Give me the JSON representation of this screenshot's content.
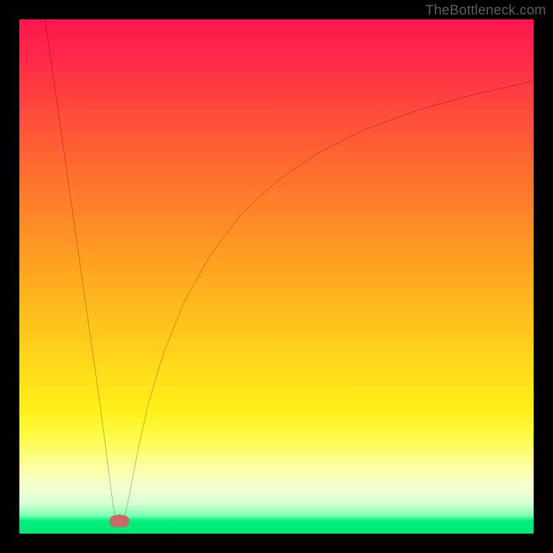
{
  "watermark": {
    "text": "TheBottleneck.com"
  },
  "colors": {
    "curve_stroke": "#000000",
    "marker_fill": "#c96864",
    "gradient_top": "#ff154e",
    "gradient_bottom": "#00e676",
    "frame": "#000000"
  },
  "chart_data": {
    "type": "line",
    "title": "",
    "xlabel": "",
    "ylabel": "",
    "xlim": [
      0,
      100
    ],
    "ylim": [
      0,
      100
    ],
    "axes_visible": false,
    "grid": false,
    "gradient_background": {
      "direction": "vertical",
      "stops": [
        {
          "pos": 0.0,
          "color": "#ff154e"
        },
        {
          "pos": 0.3,
          "color": "#ff6f2e"
        },
        {
          "pos": 0.6,
          "color": "#ffd61a"
        },
        {
          "pos": 0.86,
          "color": "#fcffa2"
        },
        {
          "pos": 0.965,
          "color": "#7dffb4"
        },
        {
          "pos": 1.0,
          "color": "#00e676"
        }
      ]
    },
    "series": [
      {
        "name": "bottleneck-curve",
        "comment": "y is bottleneck percentage (0 best at minimum, ~100 at x=0 top-left). Curve has sharp V minimum near x≈19 and asymptotically rises to ~88 at x=100.",
        "x": [
          5,
          7,
          9,
          11,
          13,
          15,
          16.5,
          17.5,
          18.3,
          19.0,
          19.8,
          20.6,
          21.5,
          23,
          25,
          28,
          32,
          37,
          43,
          50,
          58,
          67,
          77,
          88,
          100
        ],
        "y": [
          100,
          86,
          72,
          58,
          44,
          30,
          19,
          11,
          5,
          2.2,
          2.1,
          3.8,
          8,
          16,
          25,
          35,
          45,
          54,
          62,
          68.5,
          74,
          78.5,
          82.2,
          85.3,
          88
        ]
      }
    ],
    "markers": [
      {
        "name": "min-left-lobe",
        "x": 18.7,
        "y": 2.4,
        "r": 1.2,
        "color": "#c96864"
      },
      {
        "name": "min-right-lobe",
        "x": 20.2,
        "y": 2.4,
        "r": 1.2,
        "color": "#c96864"
      },
      {
        "name": "min-bridge",
        "x": 19.45,
        "y": 2.85,
        "r": 0.9,
        "color": "#c96864"
      }
    ]
  }
}
